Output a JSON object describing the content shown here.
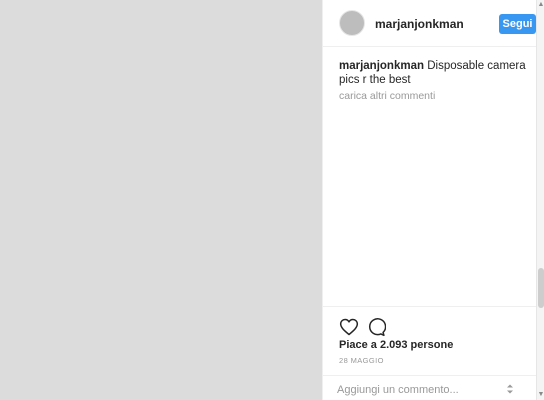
{
  "header": {
    "username": "marjanjonkman",
    "follow_label": "Segui"
  },
  "caption": {
    "username": "marjanjonkman",
    "text": "Disposable camera pics r the best"
  },
  "comments": {
    "load_more_label": "carica altri commenti"
  },
  "actions": {
    "like_icon": "heart-icon",
    "comment_icon": "speech-bubble-icon"
  },
  "likes_text": "Piace a 2.093 persone",
  "date_text": "28 MAGGIO",
  "comment_box": {
    "placeholder": "Aggiungi un commento..."
  },
  "colors": {
    "accent": "#3897f0",
    "muted_text": "#999999"
  }
}
